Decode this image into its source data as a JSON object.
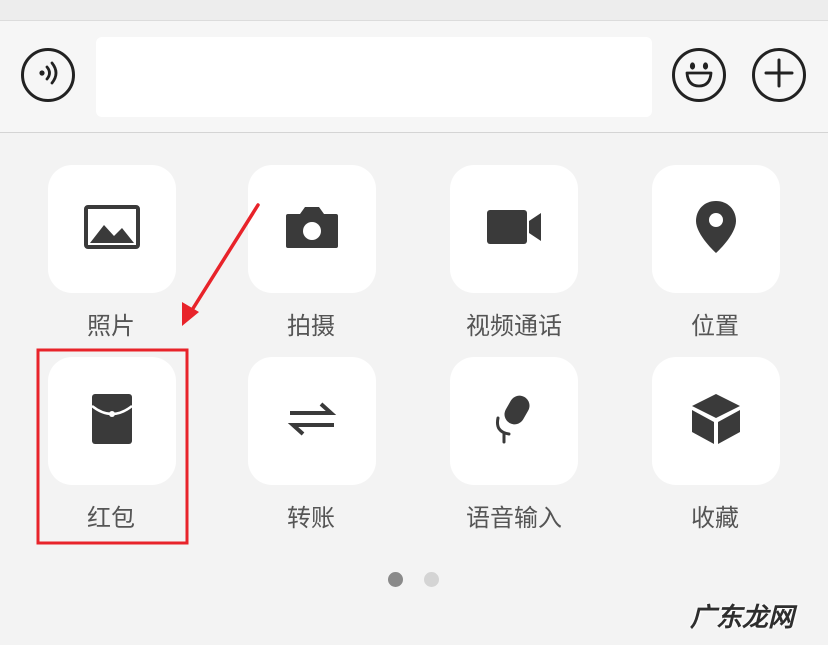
{
  "input_bar": {
    "text_value": "",
    "voice_icon": "voice-icon",
    "emoji_icon": "emoji-icon",
    "plus_icon": "plus-icon"
  },
  "panel": {
    "items": [
      {
        "label": "照片",
        "icon": "image-icon"
      },
      {
        "label": "拍摄",
        "icon": "camera-icon"
      },
      {
        "label": "视频通话",
        "icon": "video-call-icon"
      },
      {
        "label": "位置",
        "icon": "location-pin-icon"
      },
      {
        "label": "红包",
        "icon": "red-packet-icon"
      },
      {
        "label": "转账",
        "icon": "transfer-icon"
      },
      {
        "label": "语音输入",
        "icon": "microphone-icon"
      },
      {
        "label": "收藏",
        "icon": "favorites-cube-icon"
      }
    ],
    "page_indicator": {
      "current": 1,
      "total": 2
    }
  },
  "annotation": {
    "highlight_color": "#e8232a",
    "arrow_color": "#e8232a"
  },
  "watermark": {
    "text": "广东龙网"
  }
}
